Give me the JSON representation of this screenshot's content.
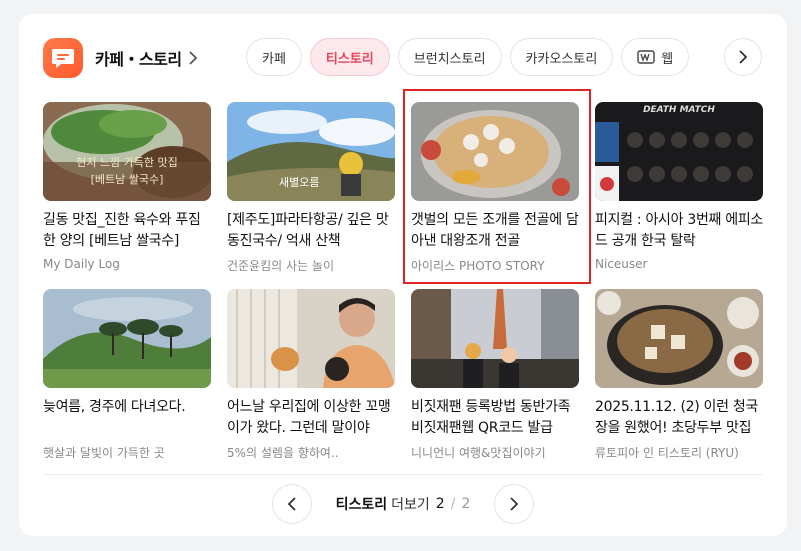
{
  "header": {
    "logo_icon": "speech-bubble-icon",
    "title": "카페・스토리",
    "chevron_icon": "chevron-right-icon"
  },
  "tabs": [
    {
      "label": "카페",
      "active": false
    },
    {
      "label": "티스토리",
      "active": true
    },
    {
      "label": "브런치스토리",
      "active": false
    },
    {
      "label": "카카오스토리",
      "active": false
    },
    {
      "label": "웹",
      "active": false
    }
  ],
  "tab_next_icon": "chevron-right-icon",
  "items": [
    {
      "title": "길동 맛집_진한 육수와 푸짐한 양의 [베트남 쌀국수]",
      "source": "My Daily Log",
      "overlay": "현지 느낌 가득한 맛집",
      "overlay2": "[베트남 쌀국수]",
      "selected": false
    },
    {
      "title": "[제주도]파라타항공/ 깊은 맛 동진국수/ 억새 산책",
      "source": "건준윤킴의 사는 놀이",
      "overlay": "새별오름",
      "selected": false
    },
    {
      "title": "갯벌의 모든 조개를 전골에 담아낸 대왕조개 전골",
      "source": "아이리스 PHOTO STORY",
      "selected": true
    },
    {
      "title": "피지컬 : 아시아 3번째 에피소드 공개 한국 탈락",
      "source": "Niceuser",
      "overlay": "DEATH MATCH",
      "selected": false
    },
    {
      "title": "늦여름, 경주에 다녀오다.",
      "source": "햇살과 달빛이 가득한 곳",
      "selected": false
    },
    {
      "title": "어느날 우리집에 이상한 꼬맹이가 왔다. 그런데 말이야",
      "source": "5%의 설렘을 향하여..",
      "selected": false
    },
    {
      "title": "비짓재팬 등록방법 동반가족 비짓재팬웹 QR코드 발급",
      "source": "니니언니 여행&맛집이야기",
      "selected": false
    },
    {
      "title": "2025.11.12. (2) 이런 청국장을 원했어! 초당두부 맛집",
      "source": "류토피아 인 티스토리 (RYU)",
      "selected": false
    }
  ],
  "pager": {
    "label_strong": "티스토리",
    "label_more": "더보기",
    "current": "2",
    "separator": "/",
    "total": "2",
    "prev_icon": "chevron-left-icon",
    "next_icon": "chevron-right-icon"
  }
}
